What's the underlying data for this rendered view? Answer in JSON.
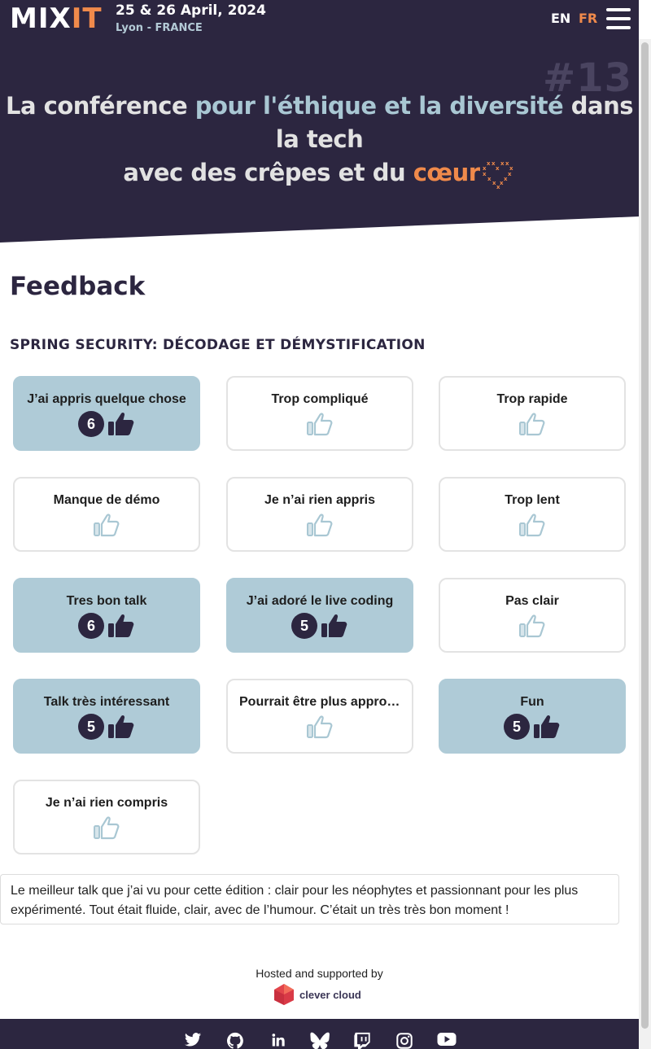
{
  "header": {
    "logo_mix": "MIX",
    "logo_it": "IT",
    "dates": "25 & 26 April, 2024",
    "location": "Lyon - FRANCE",
    "lang_en": "EN",
    "lang_fr": "FR"
  },
  "hero": {
    "edition": "#13",
    "line1_a": "La conférence ",
    "line1_b": "pour l'éthique et la diversité",
    "line1_c": " dans",
    "line2": "la tech",
    "line3_a": "avec des crêpes et du ",
    "line3_b": "cœur"
  },
  "page": {
    "title": "Feedback",
    "talk_title": "SPRING SECURITY: DÉCODAGE ET DÉMYSTIFICATION"
  },
  "feedback": [
    {
      "label": "J’ai appris quelque chose",
      "count": "6",
      "active": true
    },
    {
      "label": "Trop compliqué",
      "count": "",
      "active": false
    },
    {
      "label": "Trop rapide",
      "count": "",
      "active": false
    },
    {
      "label": "Manque de démo",
      "count": "",
      "active": false
    },
    {
      "label": "Je n’ai rien appris",
      "count": "",
      "active": false
    },
    {
      "label": "Trop lent",
      "count": "",
      "active": false
    },
    {
      "label": "Tres bon talk",
      "count": "6",
      "active": true
    },
    {
      "label": "J’ai adoré le live coding",
      "count": "5",
      "active": true
    },
    {
      "label": "Pas clair",
      "count": "",
      "active": false
    },
    {
      "label": "Talk très intéressant",
      "count": "5",
      "active": true
    },
    {
      "label": "Pourrait être plus approfondi",
      "count": "",
      "active": false
    },
    {
      "label": "Fun",
      "count": "5",
      "active": true
    },
    {
      "label": "Je n’ai rien compris",
      "count": "",
      "active": false
    }
  ],
  "comment": "Le meilleur talk que j’ai vu pour cette édition : clair pour les néophytes et passionnant pour les plus expérimenté. Tout était fluide, clair, avec de l’humour. C’était un très très bon moment !",
  "sponsor": {
    "hosted_text": "Hosted and supported by",
    "name": "clever cloud"
  },
  "footer": {
    "icons": [
      "twitter-icon",
      "github-icon",
      "linkedin-icon",
      "bluesky-icon",
      "twitch-icon",
      "instagram-icon",
      "youtube-icon"
    ]
  },
  "colors": {
    "dark": "#2c2640",
    "accent_orange": "#f08a4b",
    "accent_blue": "#a9c7d3",
    "card_active": "#afcbd7"
  }
}
